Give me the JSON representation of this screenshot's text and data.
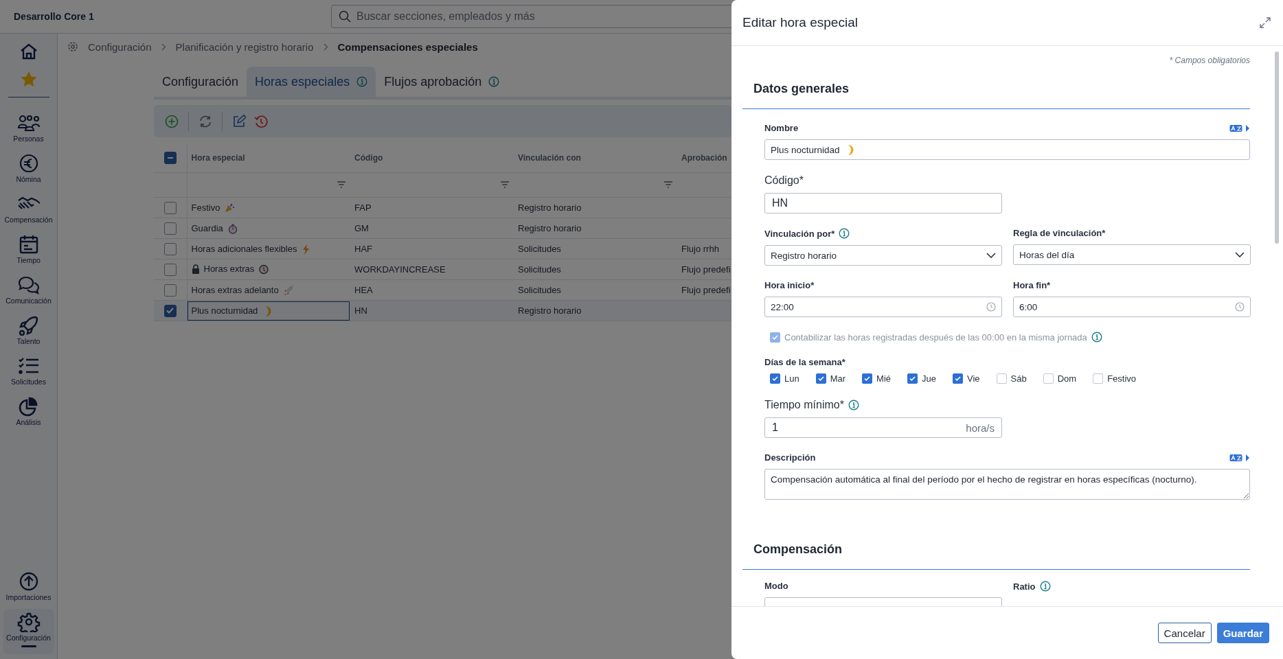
{
  "app": {
    "title": "Desarrollo Core 1",
    "search": {
      "placeholder": "Buscar secciones, empleados y más"
    }
  },
  "sidebar": {
    "items": [
      {
        "label": "Personas",
        "selected": false
      },
      {
        "label": "Nómina",
        "selected": false
      },
      {
        "label": "Compensación",
        "selected": false
      },
      {
        "label": "Tiempo",
        "selected": false
      },
      {
        "label": "Comunicación",
        "selected": false
      },
      {
        "label": "Talento",
        "selected": false
      },
      {
        "label": "Solicitudes",
        "selected": false
      },
      {
        "label": "Análisis",
        "selected": false
      }
    ],
    "bottom_items": [
      {
        "label": "Importaciones",
        "selected": false
      },
      {
        "label": "Configuración",
        "selected": true
      }
    ]
  },
  "breadcrumb": [
    "Configuración",
    "Planificación y registro horario",
    "Compensaciones especiales"
  ],
  "tabs": [
    {
      "label": "Configuración",
      "selected": false,
      "info": false
    },
    {
      "label": "Horas especiales",
      "selected": true,
      "info": true
    },
    {
      "label": "Flujos aprobación",
      "selected": false,
      "info": true
    }
  ],
  "table": {
    "select_all": {
      "indeterminate": true
    },
    "columns": [
      "Hora especial",
      "Código",
      "Vinculación con",
      "Aprobación"
    ],
    "rows": [
      {
        "name": "Festivo",
        "code": "FAP",
        "link": "Registro horario",
        "locked": false,
        "selected": false
      },
      {
        "name": "Guardia",
        "code": "GM",
        "link": "Registro horario",
        "locked": false,
        "selected": false
      },
      {
        "name": "Horas adicionales flexibles",
        "code": "HAF",
        "link": "Solicitudes",
        "approval": "Flujo rrhh",
        "locked": false,
        "selected": false
      },
      {
        "name": "Horas extras",
        "code": "WORKDAYINCREASE",
        "link": "Solicitudes",
        "approval": "Flujo predefi",
        "locked": true,
        "selected": false
      },
      {
        "name": "Horas extras adelanto",
        "code": "HEA",
        "link": "Solicitudes",
        "approval": "Flujo predefi",
        "locked": false,
        "selected": false
      },
      {
        "name": "Plus nocturnidad",
        "code": "HN",
        "link": "Registro horario",
        "locked": false,
        "selected": true
      }
    ]
  },
  "panel": {
    "title": "Editar hora especial",
    "required_note": "* Campos obligatorios",
    "general": {
      "heading": "Datos generales",
      "name": {
        "label": "Nombre",
        "value": "Plus nocturnidad"
      },
      "code": {
        "label": "Código*",
        "value": "HN"
      },
      "link_by": {
        "label": "Vinculación por*",
        "value": "Registro horario"
      },
      "link_rule": {
        "label": "Regla de vinculación*",
        "value": "Horas del día"
      },
      "start": {
        "label": "Hora inicio*",
        "value": "22:00"
      },
      "end": {
        "label": "Hora fin*",
        "value": "6:00"
      },
      "count_after_midnight": {
        "label": "Contabilizar las horas registradas después de las 00:00 en la misma jornada",
        "checked": true,
        "disabled": true
      },
      "weekdays": {
        "label": "Días de la semana*",
        "days": [
          {
            "label": "Lun",
            "checked": true
          },
          {
            "label": "Mar",
            "checked": true
          },
          {
            "label": "Mié",
            "checked": true
          },
          {
            "label": "Jue",
            "checked": true
          },
          {
            "label": "Vie",
            "checked": true
          },
          {
            "label": "Sáb",
            "checked": false
          },
          {
            "label": "Dom",
            "checked": false
          },
          {
            "label": "Festivo",
            "checked": false
          }
        ]
      },
      "min_time": {
        "label": "Tiempo mínimo*",
        "value": "1",
        "unit": "hora/s"
      },
      "description": {
        "label": "Descripción",
        "value": "Compensación automática al final del período por el hecho de registrar en horas específicas (nocturno)."
      }
    },
    "compensation": {
      "heading": "Compensación",
      "mode": {
        "label": "Modo"
      },
      "ratio": {
        "label": "Ratio"
      }
    },
    "buttons": [
      {
        "label": "Cancelar",
        "kind": "secondary"
      },
      {
        "label": "Guardar",
        "kind": "primary"
      }
    ]
  }
}
